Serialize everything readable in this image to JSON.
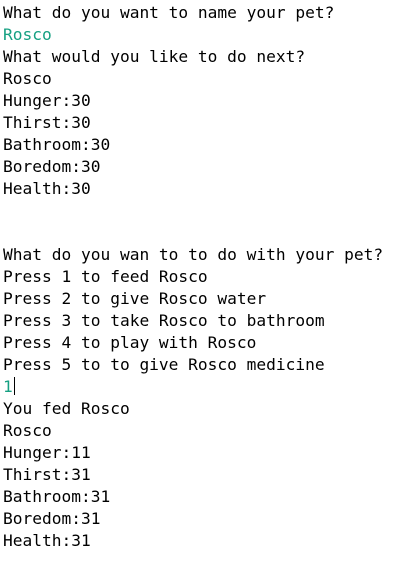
{
  "console": {
    "prompt_name": "What do you want to name your pet?",
    "input_name": "Rosco",
    "prompt_next": "What would you like to do next?",
    "status1": {
      "pet_name": "Rosco",
      "hunger": "Hunger:30",
      "thirst": "Thirst:30",
      "bathroom": "Bathroom:30",
      "boredom": "Boredom:30",
      "health": "Health:30"
    },
    "menu": {
      "question": "What do you wan to to do with your pet?",
      "options": [
        "Press 1 to feed Rosco",
        "Press 2 to give Rosco water",
        "Press 3 to take Rosco to bathroom",
        "Press 4 to play with Rosco",
        "Press 5 to to give Rosco medicine"
      ]
    },
    "input_choice": "1",
    "result": "You fed Rosco",
    "status2": {
      "pet_name": "Rosco",
      "hunger": "Hunger:11",
      "thirst": "Thirst:31",
      "bathroom": "Bathroom:31",
      "boredom": "Boredom:31",
      "health": "Health:31"
    }
  },
  "colors": {
    "text": "#000000",
    "user_input": "#16a082",
    "background": "#ffffff"
  }
}
